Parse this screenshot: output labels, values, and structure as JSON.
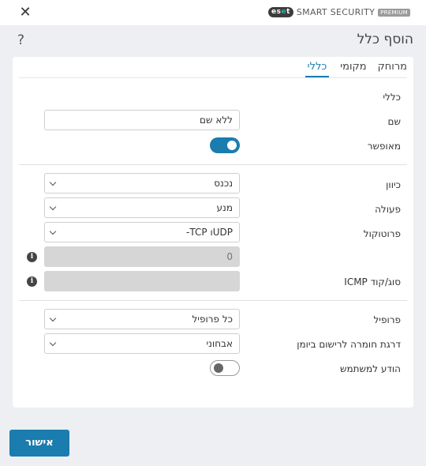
{
  "window": {
    "brand_logo": "eset",
    "brand_name": "SMART SECURITY",
    "brand_badge": "PREMIUM",
    "close_icon": "close-icon"
  },
  "header": {
    "title": "הוסף כלל",
    "help": "?"
  },
  "tabs": [
    {
      "label": "כללי",
      "active": true
    },
    {
      "label": "מקומי",
      "active": false
    },
    {
      "label": "מרוחק",
      "active": false
    }
  ],
  "general": {
    "section_title": "כללי",
    "name_label": "שם",
    "name_placeholder": "ללא שם",
    "enabled_label": "מאופשר",
    "enabled": true
  },
  "connection": {
    "direction_label": "כיוון",
    "direction_value": "נכנס",
    "action_label": "פעולה",
    "action_value": "מנע",
    "protocol_label": "פרוטוקול",
    "protocol_value": "UDPו TCP-",
    "protocol_number": "0",
    "icmp_label": "סוג/קוד ICMP",
    "icmp_value": ""
  },
  "logging": {
    "profile_label": "פרופיל",
    "profile_value": "כל פרופיל",
    "severity_label": "דרגת חומרה לרישום ביומן",
    "severity_value": "אבחוני",
    "notify_label": "הודע למשתמש",
    "notify": false
  },
  "footer": {
    "ok_label": "אישור"
  },
  "colors": {
    "accent": "#1a7caf",
    "background": "#eeeff2"
  }
}
